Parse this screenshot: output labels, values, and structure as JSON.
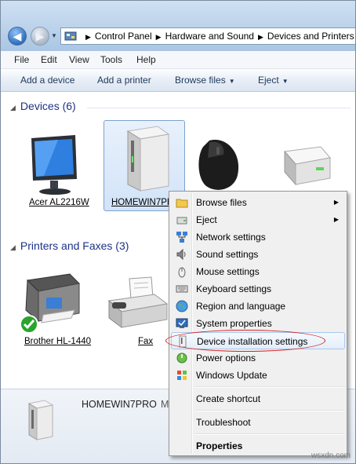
{
  "address": {
    "crumbs": [
      "Control Panel",
      "Hardware and Sound",
      "Devices and Printers"
    ]
  },
  "menu": [
    "File",
    "Edit",
    "View",
    "Tools",
    "Help"
  ],
  "commands": {
    "add_device": "Add a device",
    "add_printer": "Add a printer",
    "browse_files": "Browse files",
    "eject": "Eject"
  },
  "groups": {
    "devices": "Devices (6)",
    "printers": "Printers and Faxes (3)"
  },
  "devices": [
    "Acer AL2216W",
    "HOMEWIN7PRO"
  ],
  "printers": [
    "Brother HL-1440",
    "Fax"
  ],
  "details": {
    "name": "HOMEWIN7PRO",
    "extra": "M"
  },
  "context_menu": [
    {
      "label": "Browse files",
      "submenu": true
    },
    {
      "label": "Eject",
      "submenu": true
    },
    {
      "label": "Network settings"
    },
    {
      "label": "Sound settings"
    },
    {
      "label": "Mouse settings"
    },
    {
      "label": "Keyboard settings"
    },
    {
      "label": "Region and language"
    },
    {
      "label": "System properties"
    },
    {
      "label": "Device installation settings",
      "highlighted": true
    },
    {
      "label": "Power options"
    },
    {
      "label": "Windows Update"
    },
    {
      "label": "Create shortcut"
    },
    {
      "label": "Troubleshoot"
    },
    {
      "label": "Properties",
      "bold": true
    }
  ],
  "watermark": "wsxdn.com",
  "colors": {
    "link_blue": "#1e3287",
    "highlight_border": "#a8c8ec",
    "annotation_red": "#d82020"
  }
}
